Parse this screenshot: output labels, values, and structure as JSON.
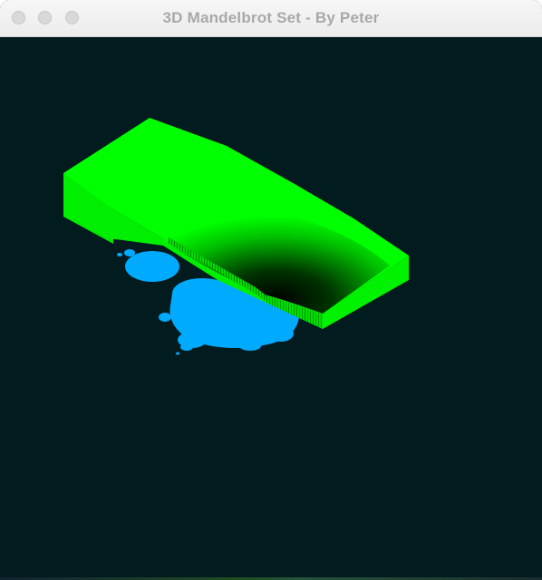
{
  "window": {
    "title": "3D Mandelbrot Set - By Peter"
  },
  "colors": {
    "background": "#021b1e",
    "surface_green": "#00ff00",
    "fractal_blue": "#00aaff"
  }
}
